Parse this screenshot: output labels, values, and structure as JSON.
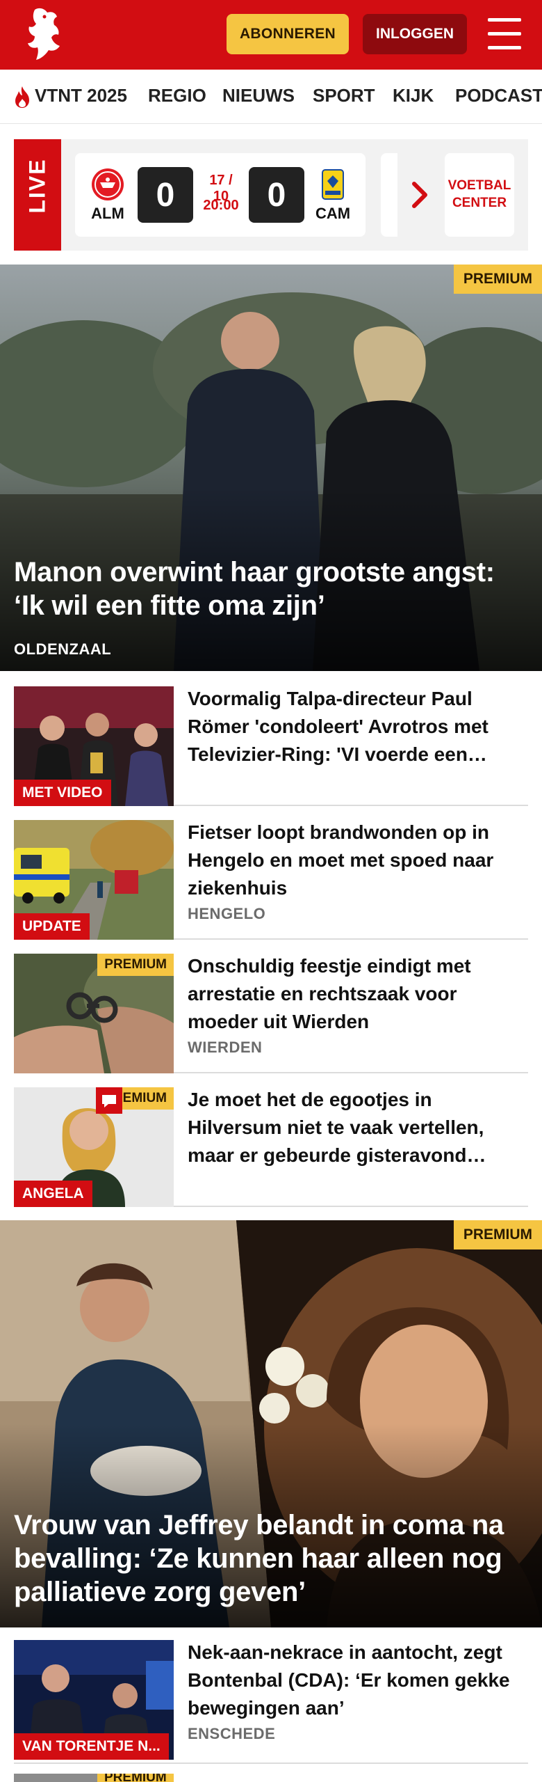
{
  "header": {
    "subscribe_label": "ABONNEREN",
    "login_label": "INLOGGEN",
    "brand_color": "#d20d12",
    "accent_color": "#f5c542"
  },
  "nav": {
    "items": [
      "VTNT 2025",
      "REGIO",
      "NIEUWS",
      "SPORT",
      "KIJK",
      "PODCAST"
    ]
  },
  "live": {
    "label": "LIVE",
    "match": {
      "home": "ALM",
      "away": "CAM",
      "home_score": "0",
      "away_score": "0",
      "date": "17 / 10",
      "time": "20:00"
    },
    "voetbal_center": "VOETBAL CENTER"
  },
  "hero1": {
    "premium": "PREMIUM",
    "title": "Manon overwint haar grootste angst: ‘Ik wil een fitte oma zijn’",
    "location": "OLDENZAAL"
  },
  "articles": [
    {
      "title": "Voormalig Talpa-directeur Paul Römer 'condoleert' Avrotros met Televizier-Ring: 'VI voerde een…",
      "badge": "MET VIDEO"
    },
    {
      "title": "Fietser loopt brandwonden op in Hengelo en moet met spoed naar ziekenhuis",
      "badge": "UPDATE",
      "location": "HENGELO"
    },
    {
      "title": "Onschuldig feestje eindigt met arrestatie en rechtszaak voor moeder uit Wierden",
      "premium": "PREMIUM",
      "location": "WIERDEN"
    },
    {
      "title": "Je moet het de egootjes in Hilversum niet te vaak vertellen, maar er gebeurde gisteravond…",
      "premium": "PREMIUM",
      "badge": "ANGELA"
    }
  ],
  "hero2": {
    "premium": "PREMIUM",
    "title": "Vrouw van Jeffrey belandt in coma na bevalling: ‘Ze kunnen haar alleen nog palliatieve zorg geven’"
  },
  "articles2": [
    {
      "title": "Nek-aan-nekrace in aantocht, zegt Bontenbal (CDA): ‘Er komen gekke bewegingen aan’",
      "badge": "VAN TORENTJE N...",
      "location": "ENSCHEDE"
    },
    {
      "premium": "PREMIUM"
    }
  ]
}
